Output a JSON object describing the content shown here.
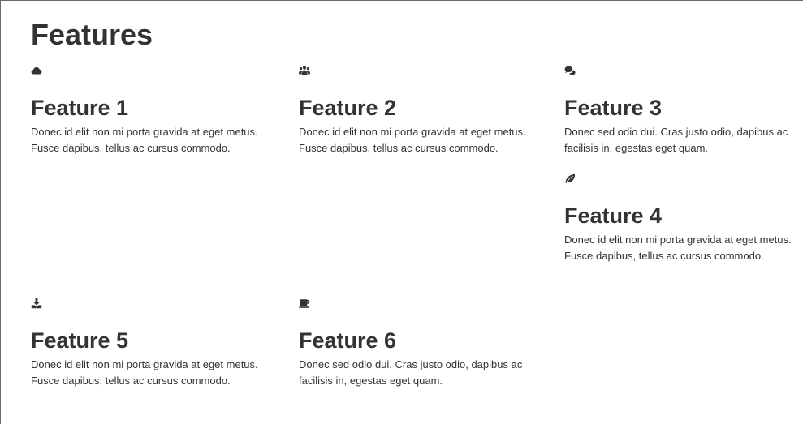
{
  "page": {
    "title": "Features"
  },
  "features": [
    {
      "icon": "cloud-icon",
      "title": "Feature 1",
      "text": "Donec id elit non mi porta gravida at eget metus. Fusce dapibus, tellus ac cursus commodo."
    },
    {
      "icon": "group-icon",
      "title": "Feature 2",
      "text": "Donec id elit non mi porta gravida at eget metus. Fusce dapibus, tellus ac cursus commodo."
    },
    {
      "icon": "comments-icon",
      "title": "Feature 3",
      "text": "Donec sed odio dui. Cras justo odio, dapibus ac facilisis in, egestas eget quam."
    },
    {
      "icon": "leaf-icon",
      "title": "Feature 4",
      "text": "Donec id elit non mi porta gravida at eget metus. Fusce dapibus, tellus ac cursus commodo."
    },
    {
      "icon": "download-icon",
      "title": "Feature 5",
      "text": "Donec id elit non mi porta gravida at eget metus. Fusce dapibus, tellus ac cursus commodo."
    },
    {
      "icon": "coffee-icon",
      "title": "Feature 6",
      "text": "Donec sed odio dui. Cras justo odio, dapibus ac facilisis in, egestas eget quam."
    }
  ],
  "colors": {
    "text": "#333333",
    "background": "#ffffff"
  }
}
